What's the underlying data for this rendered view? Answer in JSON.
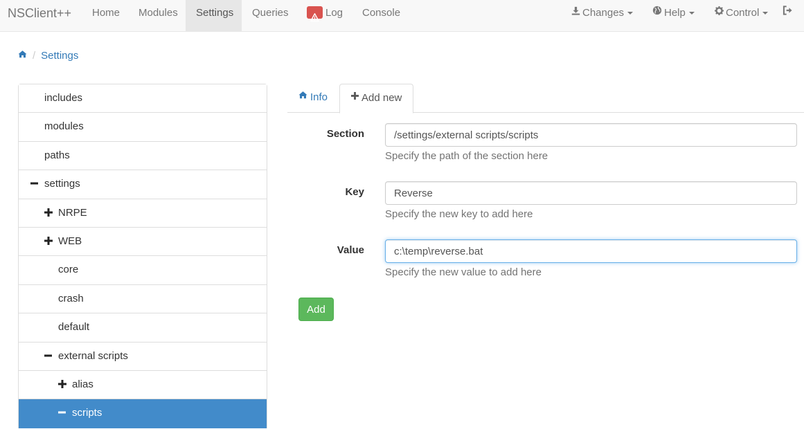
{
  "navbar": {
    "brand": "NSClient++",
    "items": [
      "Home",
      "Modules",
      "Settings",
      "Queries",
      "Log",
      "Console"
    ],
    "active": "Settings",
    "right": {
      "changes": "Changes",
      "help": "Help",
      "control": "Control"
    }
  },
  "breadcrumb": {
    "current": "Settings"
  },
  "tree": {
    "items": [
      {
        "label": "includes",
        "icon": ""
      },
      {
        "label": "modules",
        "icon": ""
      },
      {
        "label": "paths",
        "icon": ""
      },
      {
        "label": "settings",
        "icon": "minus-icon"
      },
      {
        "label": "NRPE",
        "icon": "plus-icon"
      },
      {
        "label": "WEB",
        "icon": "plus-icon"
      },
      {
        "label": "core",
        "icon": ""
      },
      {
        "label": "crash",
        "icon": ""
      },
      {
        "label": "default",
        "icon": ""
      },
      {
        "label": "external scripts",
        "icon": "minus-icon"
      },
      {
        "label": "alias",
        "icon": "plus-icon"
      },
      {
        "label": "scripts",
        "icon": "minus-icon",
        "active": true
      }
    ]
  },
  "tabs": {
    "info": "Info",
    "add_new": "Add new"
  },
  "form": {
    "section": {
      "label": "Section",
      "value": "/settings/external scripts/scripts",
      "help": "Specify the path of the section here"
    },
    "key": {
      "label": "Key",
      "value": "Reverse",
      "help": "Specify the new key to add here"
    },
    "value": {
      "label": "Value",
      "value": "c:\\temp\\reverse.bat",
      "help": "Specify the new value to add here"
    },
    "add_button": "Add"
  },
  "colors": {
    "link": "#337ab7",
    "active_item": "#428bca",
    "add_button": "#5cb85c",
    "log_badge": "#d9534f"
  }
}
